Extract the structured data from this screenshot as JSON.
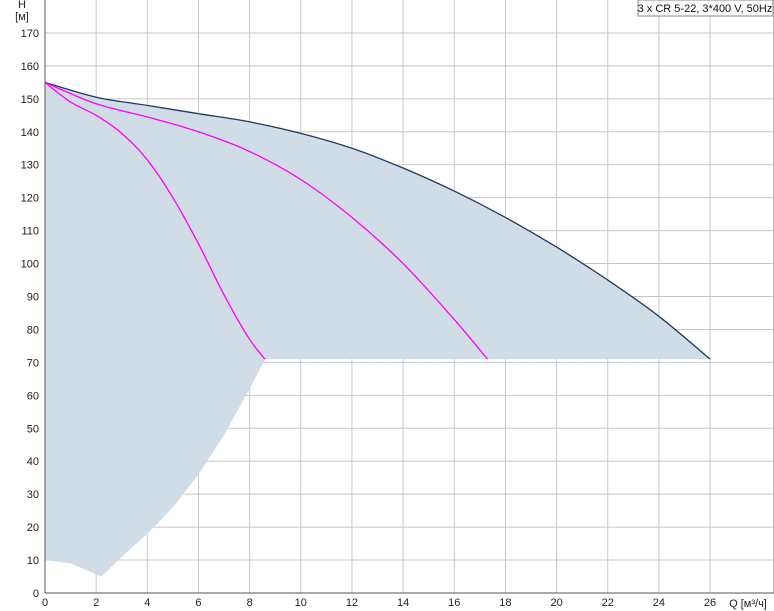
{
  "chart_data": {
    "type": "line",
    "legend": "3 x CR 5-22, 3*400 V, 50Hz",
    "legend_position": "top-right",
    "xlabel": "Q [м³/ч]",
    "ylabel": "H",
    "ylabel_unit": "[м]",
    "xlim": [
      0,
      28.5
    ],
    "ylim": [
      0,
      180
    ],
    "grid": true,
    "x_ticks": [
      0,
      2,
      4,
      6,
      8,
      10,
      12,
      14,
      16,
      18,
      20,
      22,
      24,
      26
    ],
    "y_ticks": [
      0,
      10,
      20,
      30,
      40,
      50,
      60,
      70,
      80,
      90,
      100,
      110,
      120,
      130,
      140,
      150,
      160,
      170
    ],
    "colors": {
      "grid": "#c8c8c8",
      "area_fill": "#d0dce6",
      "envelope_line": "#1f3a5f",
      "partial_curves": "#ff00ff"
    },
    "area": {
      "x": [
        0,
        2,
        4,
        6,
        8,
        10,
        12,
        14,
        16,
        18,
        20,
        22,
        24,
        26,
        26,
        8.6,
        8.0,
        7.0,
        6.0,
        5.0,
        4.0,
        3.0,
        2.2,
        1.0,
        0
      ],
      "y": [
        155,
        150.5,
        148,
        145.5,
        143,
        139.5,
        135,
        129,
        122,
        114,
        105,
        95,
        84,
        71,
        71,
        71,
        62,
        48,
        36,
        26,
        18,
        11,
        5,
        9,
        10
      ]
    },
    "series": [
      {
        "x": [
          0,
          2,
          4,
          6,
          8,
          10,
          12,
          14,
          16,
          18,
          20,
          22,
          24,
          26
        ],
        "y": [
          155,
          150.5,
          148,
          145.5,
          143,
          139.5,
          135,
          129,
          122,
          114,
          105,
          95,
          84,
          71
        ]
      },
      {
        "x": [
          0,
          2,
          4,
          6,
          8,
          10,
          12,
          14,
          16,
          17.3
        ],
        "y": [
          155,
          148.5,
          144.5,
          140,
          134,
          125.5,
          114,
          100,
          83,
          71
        ]
      },
      {
        "x": [
          0,
          1,
          2,
          3,
          4,
          5,
          6,
          7,
          8,
          8.6
        ],
        "y": [
          155,
          149,
          145,
          139.5,
          131.5,
          120,
          106,
          90.5,
          77,
          71
        ]
      }
    ]
  }
}
